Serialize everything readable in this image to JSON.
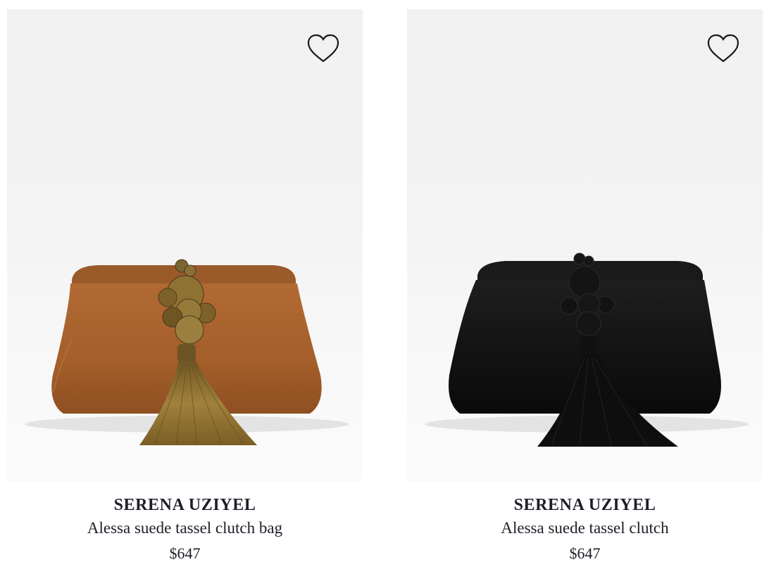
{
  "products": [
    {
      "brand": "SERENA UZIYEL",
      "name": "Alessa suede tassel clutch bag",
      "price": "$647",
      "image": {
        "bag_color": "#a8622e",
        "frame_color": "#9a5a2a",
        "tassel_color": "#8a6d32",
        "icon": "bag-image"
      },
      "wishlist_icon": "heart-outline-icon"
    },
    {
      "brand": "SERENA UZIYEL",
      "name": "Alessa suede tassel clutch",
      "price": "$647",
      "image": {
        "bag_color": "#121212",
        "frame_color": "#1a1a1a",
        "tassel_color": "#0e0e0e",
        "icon": "bag-image"
      },
      "wishlist_icon": "heart-outline-icon"
    }
  ]
}
